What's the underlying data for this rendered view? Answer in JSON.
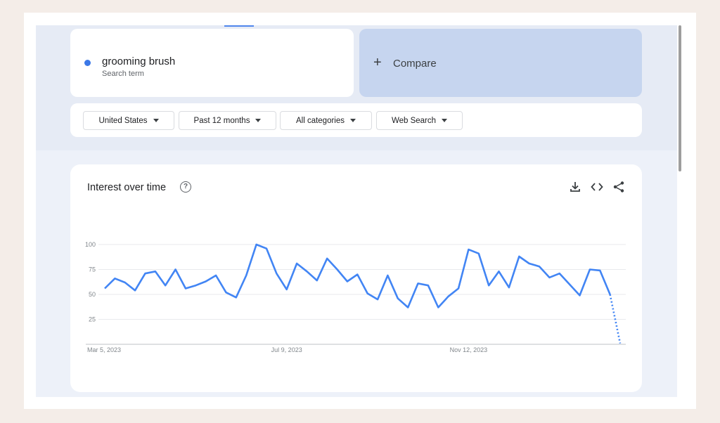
{
  "search_term": {
    "name": "grooming brush",
    "subtitle": "Search term",
    "color": "#3b78e7"
  },
  "compare": {
    "icon": "plus-icon",
    "label": "Compare"
  },
  "filters": [
    {
      "label": "United States"
    },
    {
      "label": "Past 12 months"
    },
    {
      "label": "All categories"
    },
    {
      "label": "Web Search"
    }
  ],
  "chart_card": {
    "title": "Interest over time",
    "icons": [
      "help-icon",
      "download-icon",
      "embed-icon",
      "share-icon"
    ]
  },
  "chart_data": {
    "type": "line",
    "title": "Interest over time",
    "xlabel": "",
    "ylabel": "",
    "ylim": [
      0,
      100
    ],
    "yticks": [
      25,
      50,
      75,
      100
    ],
    "xtick_labels": [
      "Mar 5, 2023",
      "Jul 9, 2023",
      "Nov 12, 2023"
    ],
    "grid": true,
    "series": [
      {
        "color": "#4285f4",
        "values": [
          56,
          66,
          62,
          54,
          71,
          73,
          59,
          75,
          56,
          59,
          63,
          69,
          52,
          47,
          69,
          100,
          96,
          71,
          55,
          81,
          73,
          64,
          86,
          75,
          63,
          70,
          51,
          45,
          69,
          46,
          37,
          61,
          59,
          37,
          48,
          56,
          95,
          91,
          59,
          73,
          57,
          88,
          81,
          78,
          67,
          71,
          60,
          49,
          75,
          74,
          50
        ],
        "partial_values": [
          50,
          1
        ]
      }
    ]
  }
}
